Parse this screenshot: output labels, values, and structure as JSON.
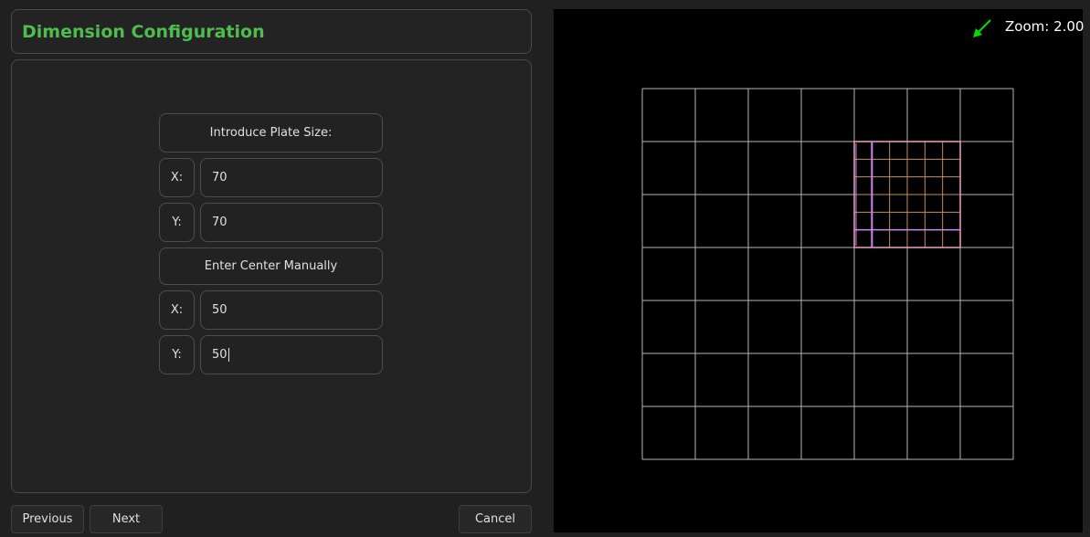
{
  "header": {
    "title": "Dimension Configuration"
  },
  "form": {
    "plate_size_label": "Introduce Plate Size:",
    "plate_x_label": "X:",
    "plate_x_value": "70",
    "plate_y_label": "Y:",
    "plate_y_value": "70",
    "center_label": "Enter Center Manually",
    "center_x_label": "X:",
    "center_x_value": "50",
    "center_y_label": "Y:",
    "center_y_value": "50"
  },
  "footer": {
    "previous_label": "Previous",
    "next_label": "Next",
    "cancel_label": "Cancel"
  },
  "viewer": {
    "zoom_text": "Zoom: 2.00",
    "arrow_icon": "arrow-down-left-icon",
    "colors": {
      "background": "#000000",
      "grid": "#b4b4b4",
      "plate_outline": "#f0a0c0",
      "plate_grid": "#c09060",
      "plate_highlight": "#cc88ee",
      "arrow": "#00dd00",
      "title_accent": "#4ebd4e"
    }
  }
}
